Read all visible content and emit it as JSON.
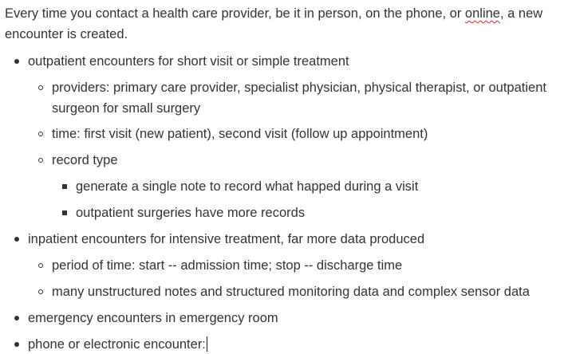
{
  "intro": {
    "before": "Every time you contact a health care provider, be it in person, on the phone, or ",
    "flagged_word": "online",
    "after": ", a new encounter is created."
  },
  "items": {
    "outpatient": "outpatient encounters for short visit or simple treatment",
    "providers": "providers: primary care provider, specialist physician, physical therapist, or outpatient surgeon for small surgery",
    "time": "time: first visit (new patient), second visit (follow up appointment)",
    "record_type": "record type",
    "single_note": "generate a single note to record what happed during a visit",
    "outpatient_surgeries": "outpatient surgeries have more records",
    "inpatient": "inpatient encounters for intensive treatment, far more data produced",
    "period": "period of time: start -- admission time; stop -- discharge time",
    "unstructured": "many unstructured notes and structured monitoring data and complex sensor data",
    "emergency": "emergency encounters in emergency room",
    "phone": "phone or electronic encounter:"
  },
  "colors": {
    "text": "#333333",
    "spellcheck_underline": "#d32f2f"
  }
}
